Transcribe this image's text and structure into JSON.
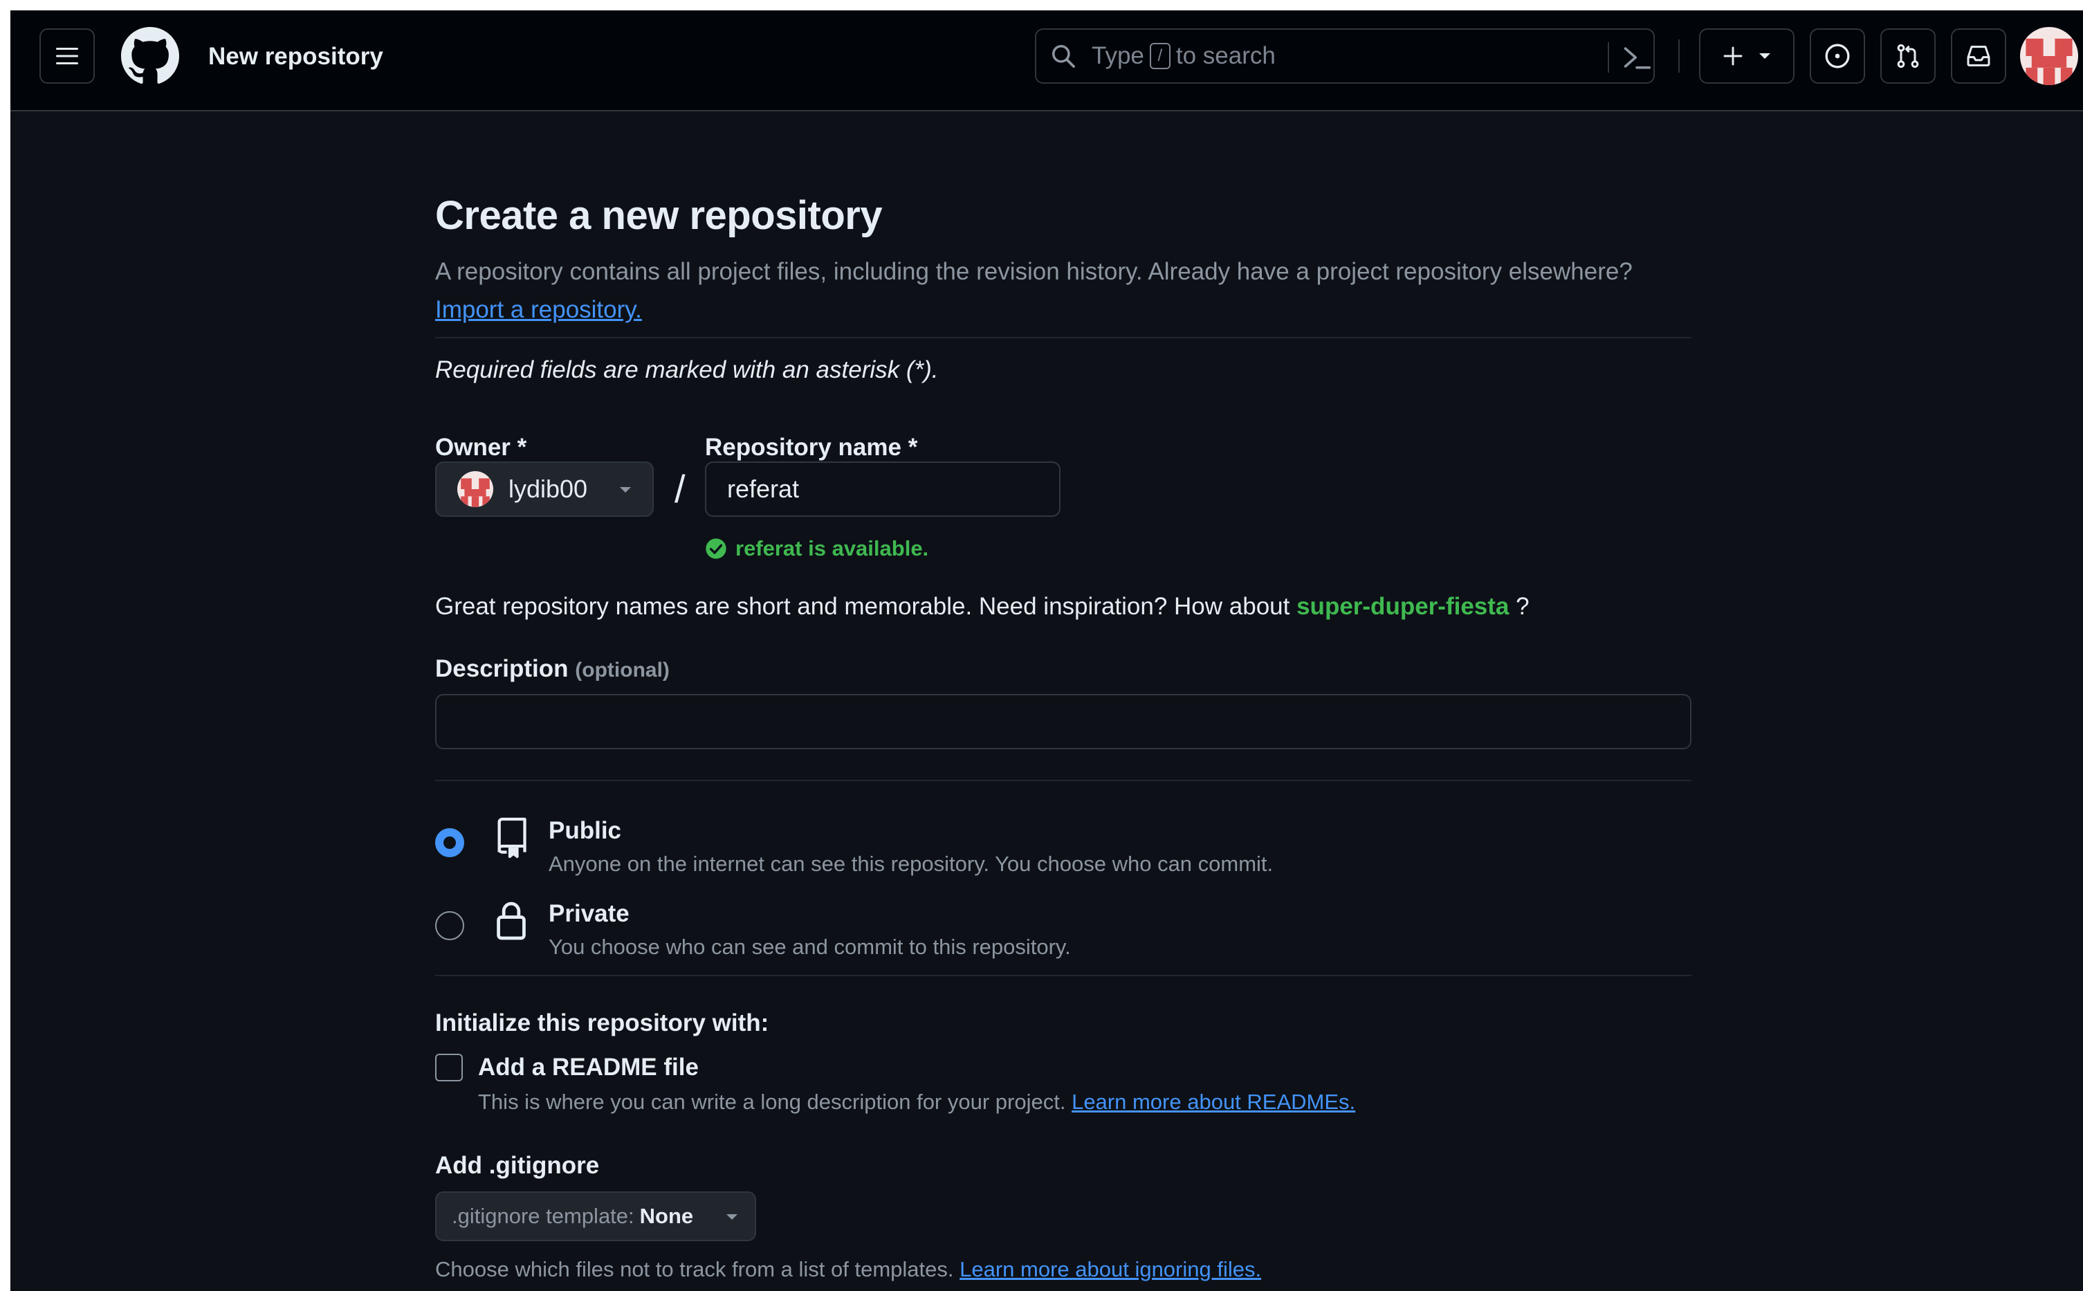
{
  "header": {
    "context_title": "New repository",
    "search": {
      "prefix": "Type",
      "key": "/",
      "suffix": "to search"
    }
  },
  "page": {
    "title": "Create a new repository",
    "intro_text": "A repository contains all project files, including the revision history. Already have a project repository elsewhere?",
    "import_link": "Import a repository.",
    "required_note": "Required fields are marked with an asterisk (*).",
    "owner": {
      "label": "Owner *",
      "value": "lydib00"
    },
    "separator": "/",
    "repo_name": {
      "label": "Repository name *",
      "value": "referat",
      "availability": "referat is available."
    },
    "inspiration": {
      "text": "Great repository names are short and memorable. Need inspiration? How about",
      "suggestion": "super-duper-fiesta",
      "suffix": "?"
    },
    "description": {
      "label": "Description",
      "optional": "(optional)",
      "value": ""
    },
    "visibility": {
      "public": {
        "title": "Public",
        "description": "Anyone on the internet can see this repository. You choose who can commit.",
        "selected": true
      },
      "private": {
        "title": "Private",
        "description": "You choose who can see and commit to this repository.",
        "selected": false
      }
    },
    "initialize": {
      "heading": "Initialize this repository with:",
      "readme": {
        "label": "Add a README file",
        "description": "This is where you can write a long description for your project.",
        "link": "Learn more about READMEs.",
        "checked": false
      }
    },
    "gitignore": {
      "heading": "Add .gitignore",
      "select_prefix": ".gitignore template:",
      "select_value": "None",
      "description": "Choose which files not to track from a list of templates.",
      "link": "Learn more about ignoring files."
    }
  },
  "colors": {
    "background": "#0d1117",
    "header_bg": "#010409",
    "accent_blue": "#4493f8",
    "success_green": "#3fb950",
    "text_primary": "#e6edf3",
    "text_muted": "#8d96a0"
  }
}
